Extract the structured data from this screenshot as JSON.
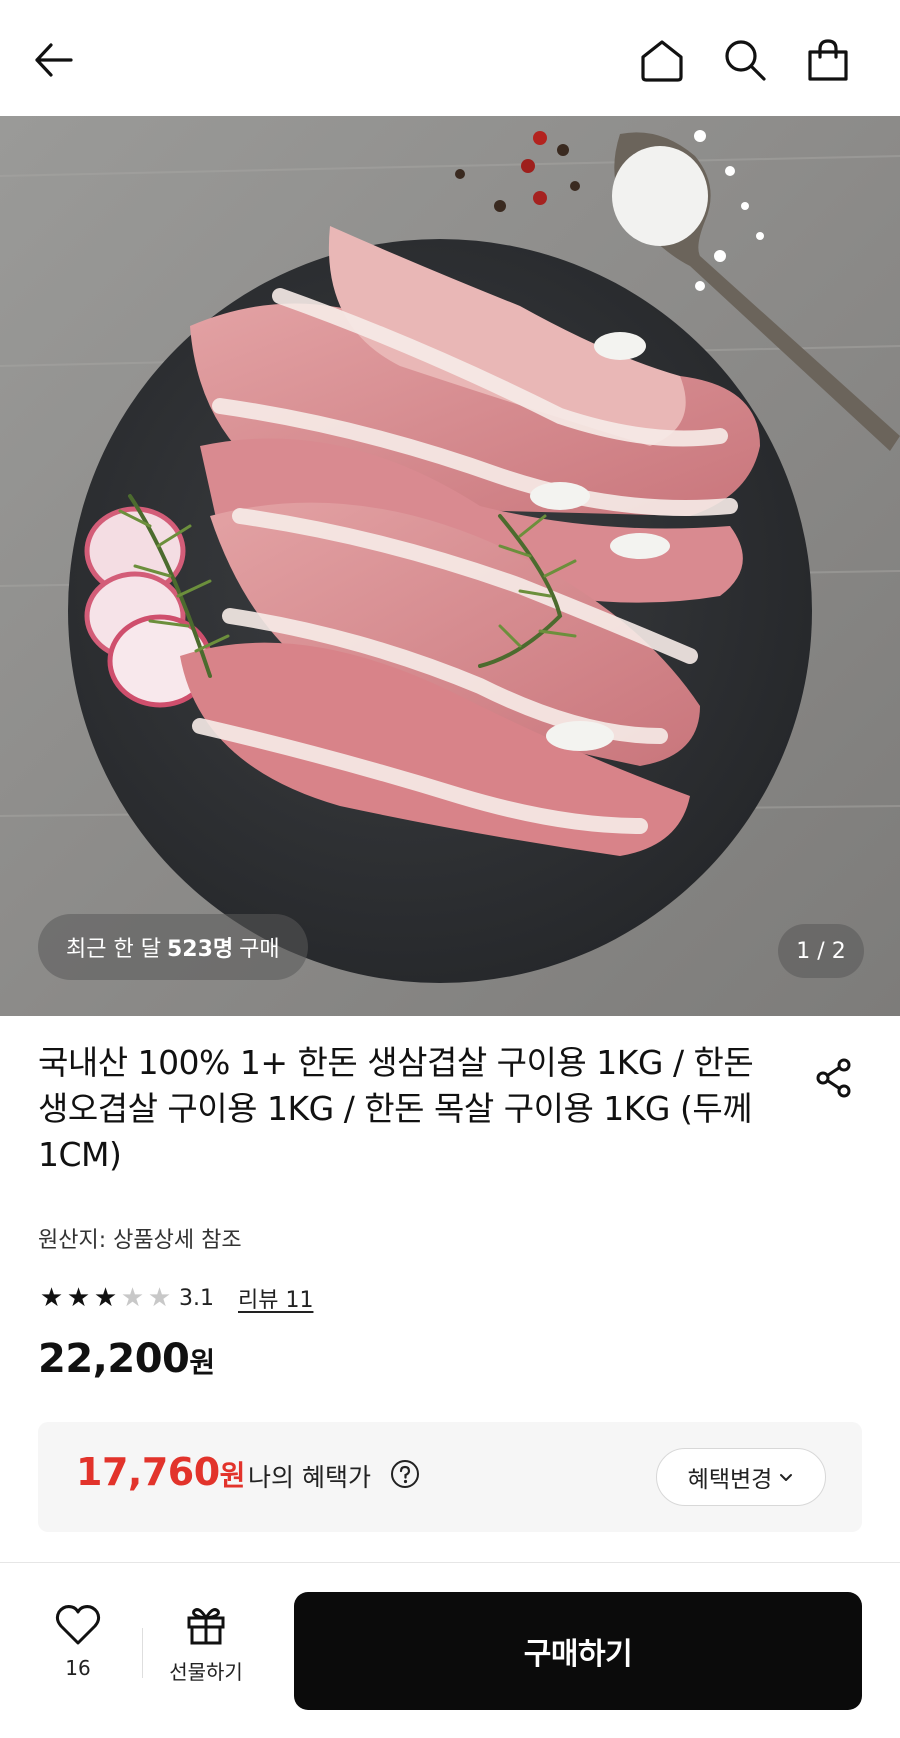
{
  "header": {
    "back_icon": "arrow-left-icon",
    "home_icon": "home-icon",
    "search_icon": "search-icon",
    "cart_icon": "shopping-bag-icon"
  },
  "hero": {
    "recent_prefix": "최근 한 달",
    "recent_count": "523명",
    "recent_suffix": "구매",
    "page_indicator": "1 / 2"
  },
  "product": {
    "title": "국내산 100% 1+ 한돈 생삼겹살 구이용 1KG / 한돈 생오겹살 구이용 1KG / 한돈 목살 구이용 1KG (두께 1CM)",
    "origin": "원산지: 상품상세 참조",
    "rating": 3.1,
    "rating_text": "3.1",
    "review_text": "리뷰 11",
    "price_number": "22,200",
    "price_unit": "원"
  },
  "benefit": {
    "price_number": "17,760",
    "price_unit": "원",
    "label": "나의 혜택가",
    "change_button": "혜택변경"
  },
  "bottom_bar": {
    "like_count": "16",
    "gift_label": "선물하기",
    "buy_label": "구매하기"
  },
  "colors": {
    "accent_red": "#e2332b",
    "buy_button": "#0b0b0b",
    "benefit_bg": "#f6f6f6"
  }
}
